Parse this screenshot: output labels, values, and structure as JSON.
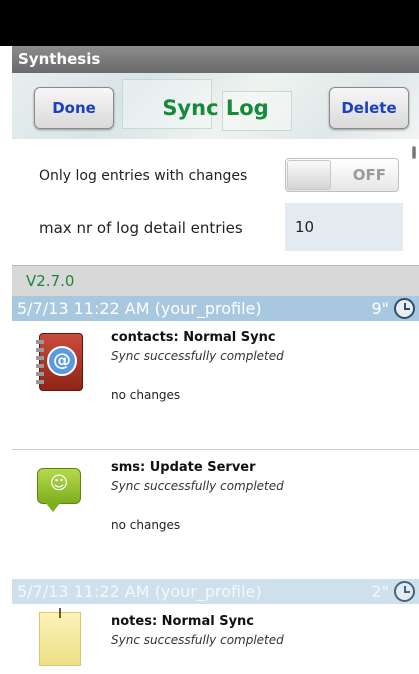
{
  "app": {
    "window_title": "Synthesis"
  },
  "nav": {
    "done_label": "Done",
    "title": "Sync Log",
    "delete_label": "Delete"
  },
  "settings": {
    "only_changes_label": "Only log entries with changes",
    "only_changes_toggle": "OFF",
    "max_entries_label": "max nr of log detail entries",
    "max_entries_value": "10"
  },
  "version": "V2.7.0",
  "sessions": [
    {
      "header": "5/7/13  11:22 AM  (your_profile)",
      "duration": "9\"",
      "items": [
        {
          "name": "contacts: Normal Sync",
          "status": "Sync successfully completed",
          "changes": "no changes",
          "icon": "contacts-icon"
        },
        {
          "name": "sms: Update Server",
          "status": "Sync successfully completed",
          "changes": "no changes",
          "icon": "sms-icon"
        }
      ]
    },
    {
      "header": "5/7/13  11:22 AM  (your_profile)",
      "duration": "2\"",
      "items": [
        {
          "name": "notes: Normal Sync",
          "status": "Sync successfully completed",
          "icon": "notes-icon"
        }
      ]
    }
  ],
  "colors": {
    "accent_green": "#148a3a",
    "button_blue": "#1a3fbf",
    "header_blue": "#a8c8e0"
  }
}
